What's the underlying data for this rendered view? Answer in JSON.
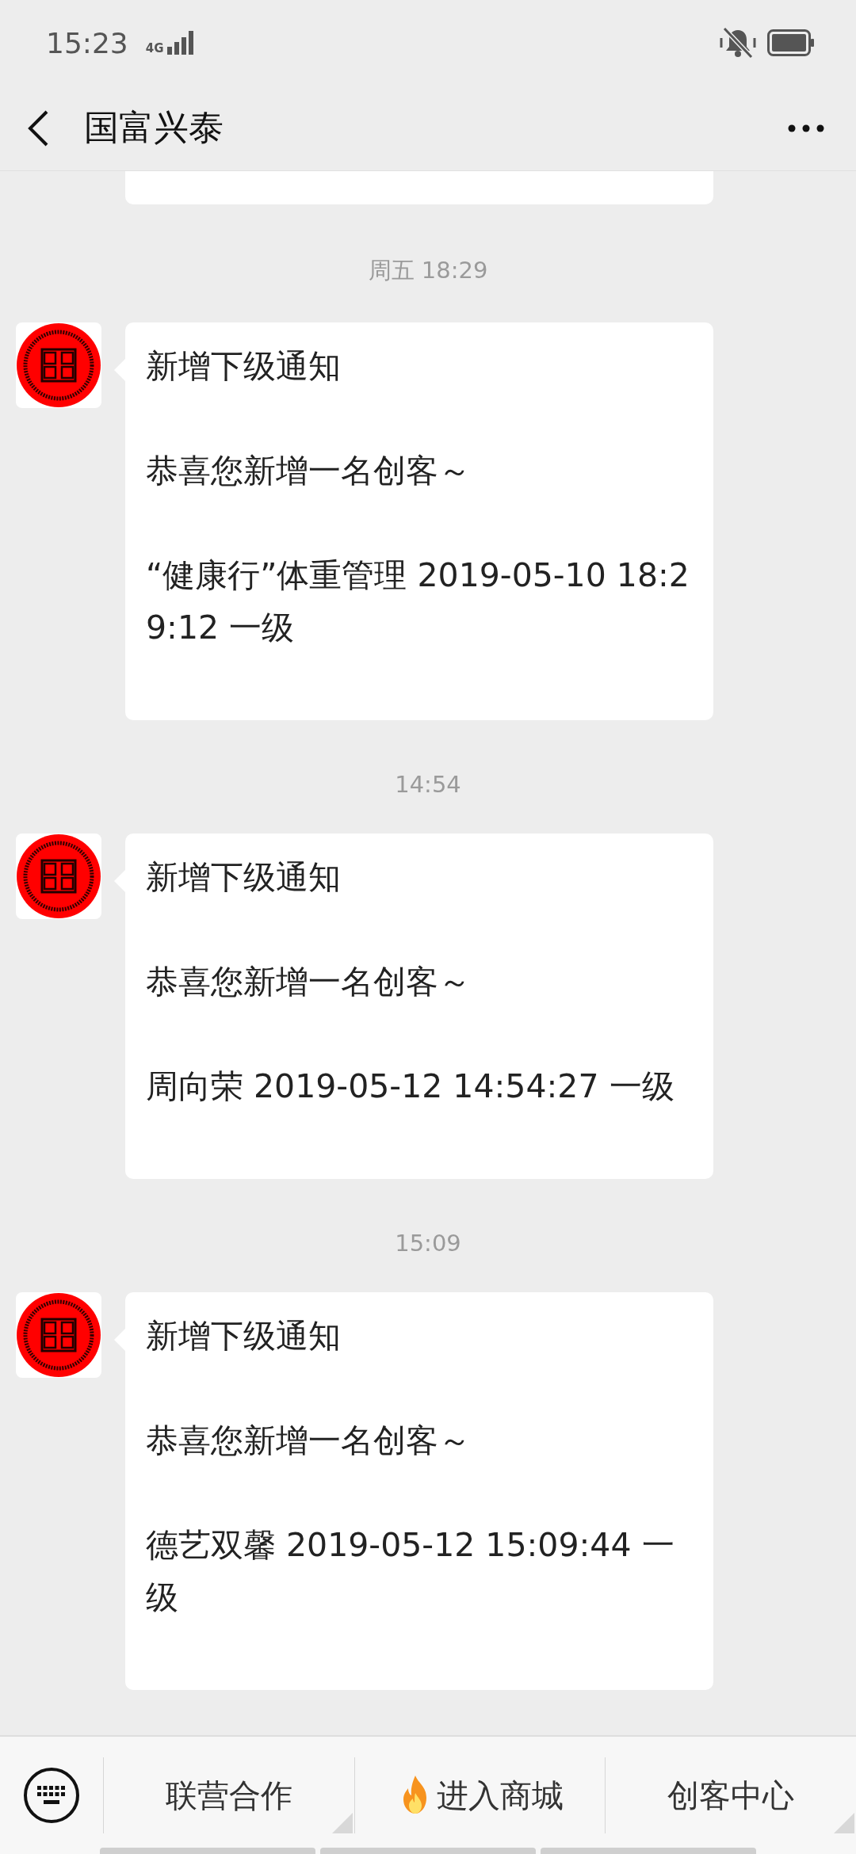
{
  "status_bar": {
    "time": "15:23",
    "network": "4G"
  },
  "header": {
    "title": "国富兴泰"
  },
  "messages": [
    {
      "kind": "partial"
    },
    {
      "kind": "notice",
      "time": "周五 18:29",
      "title": "新增下级通知",
      "greeting": "恭喜您新增一名创客～",
      "detail": "“健康行”体重管理 2019-05-10 18:29:12 一级"
    },
    {
      "kind": "notice",
      "time": "14:54",
      "title": "新增下级通知",
      "greeting": "恭喜您新增一名创客～",
      "detail": "周向荣 2019-05-12 14:54:27 一级"
    },
    {
      "kind": "notice",
      "time": "15:09",
      "title": "新增下级通知",
      "greeting": "恭喜您新增一名创客～",
      "detail": "德艺双馨 2019-05-12 15:09:44 一级"
    }
  ],
  "menu": [
    {
      "kind": "submenu",
      "label": "联营合作"
    },
    {
      "kind": "featured",
      "label": "进入商城"
    },
    {
      "kind": "submenu",
      "label": "创客中心"
    }
  ]
}
